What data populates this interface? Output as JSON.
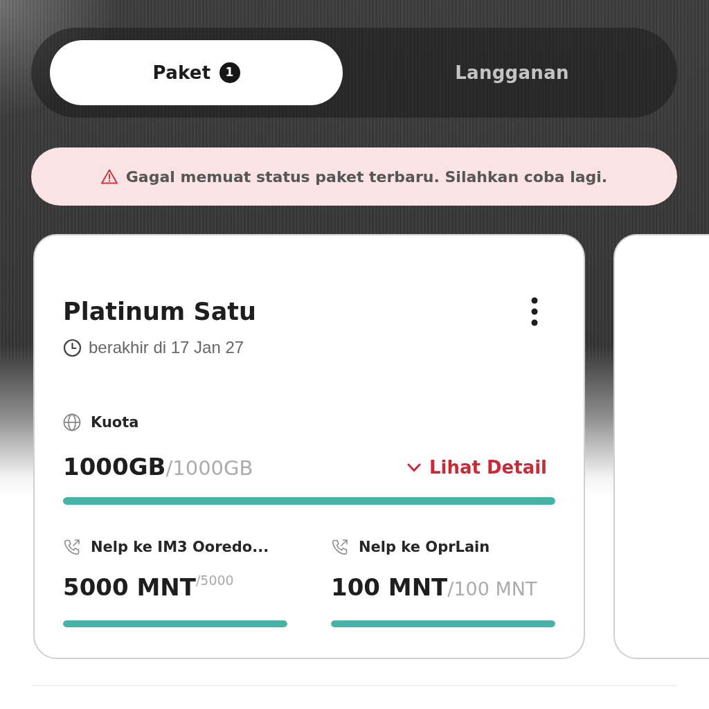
{
  "tabs": [
    {
      "label": "Paket",
      "badge": "1",
      "selected": true
    },
    {
      "label": "Langganan",
      "selected": false
    }
  ],
  "alert": {
    "kind": "error",
    "message": "Gagal memuat status paket terbaru. Silahkan coba lagi."
  },
  "package": {
    "name": "Platinum Satu",
    "expiry": "berakhir di 17 Jan 27",
    "quota": {
      "label": "Kuota",
      "remaining": "1000GB",
      "total": "/1000GB",
      "level": 1,
      "detail_link": "Lihat Detail"
    },
    "allowances": [
      {
        "label": "Nelp ke IM3 Ooredo...",
        "remaining": "5000 MNT",
        "total": "$^{/5000}$",
        "level": 1
      },
      {
        "label": "Nelp ke OprLain",
        "remaining": "100 MNT",
        "total": "/100 MNT",
        "level": 1
      }
    ]
  }
}
